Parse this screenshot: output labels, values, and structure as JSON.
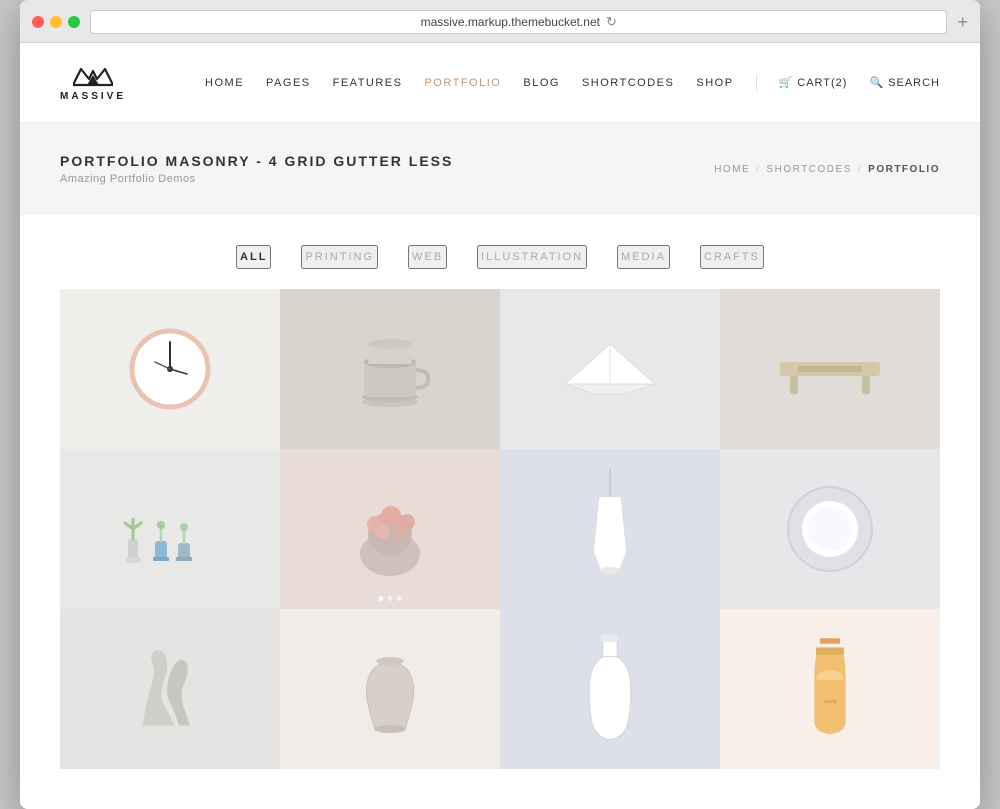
{
  "browser": {
    "url": "massive.markup.themebucket.net",
    "new_tab_label": "+"
  },
  "header": {
    "logo_text": "MASSIVE",
    "nav_items": [
      {
        "label": "HOME",
        "active": false
      },
      {
        "label": "PAGES",
        "active": false
      },
      {
        "label": "FEATURES",
        "active": false
      },
      {
        "label": "PORTFOLIO",
        "active": true
      },
      {
        "label": "BLOG",
        "active": false
      },
      {
        "label": "SHORTCODES",
        "active": false
      },
      {
        "label": "SHOP",
        "active": false
      }
    ],
    "cart_label": "CART(2)",
    "search_label": "SEARCH"
  },
  "page_header": {
    "title": "PORTFOLIO MASONRY - 4 GRID GUTTER LESS",
    "subtitle": "Amazing Portfolio Demos",
    "breadcrumb": [
      "HOME",
      "SHORTCODES",
      "PORTFOLIO"
    ]
  },
  "filters": [
    {
      "label": "ALL",
      "active": true
    },
    {
      "label": "PRINTING",
      "active": false
    },
    {
      "label": "WEB",
      "active": false
    },
    {
      "label": "ILLUSTRATION",
      "active": false
    },
    {
      "label": "MEDIA",
      "active": false
    },
    {
      "label": "CRAFTS",
      "active": false
    }
  ],
  "portfolio": {
    "items": [
      {
        "id": 1,
        "bg": "#f0eeeb",
        "type": "clock"
      },
      {
        "id": 2,
        "bg": "#d8d5cf",
        "type": "cup"
      },
      {
        "id": 3,
        "bg": "#e8e8e8",
        "type": "boat"
      },
      {
        "id": 4,
        "bg": "#e0ddd8",
        "type": "bench"
      },
      {
        "id": 5,
        "bg": "#e8e8e6",
        "type": "plants"
      },
      {
        "id": 6,
        "bg": "#e8dbd8",
        "type": "flower",
        "has_dots": true
      },
      {
        "id": 7,
        "bg": "#dde0e8",
        "type": "lamp"
      },
      {
        "id": 8,
        "bg": "#e8e6e8",
        "type": "light"
      },
      {
        "id": 9,
        "bg": "#e6e4e2",
        "type": "sculpture"
      },
      {
        "id": 10,
        "bg": "#f0ece8",
        "type": "vase2"
      },
      {
        "id": 11,
        "bg": "#dde0e8",
        "type": "bottle"
      },
      {
        "id": 12,
        "bg": "#f8f0e8",
        "type": "juice"
      }
    ]
  }
}
